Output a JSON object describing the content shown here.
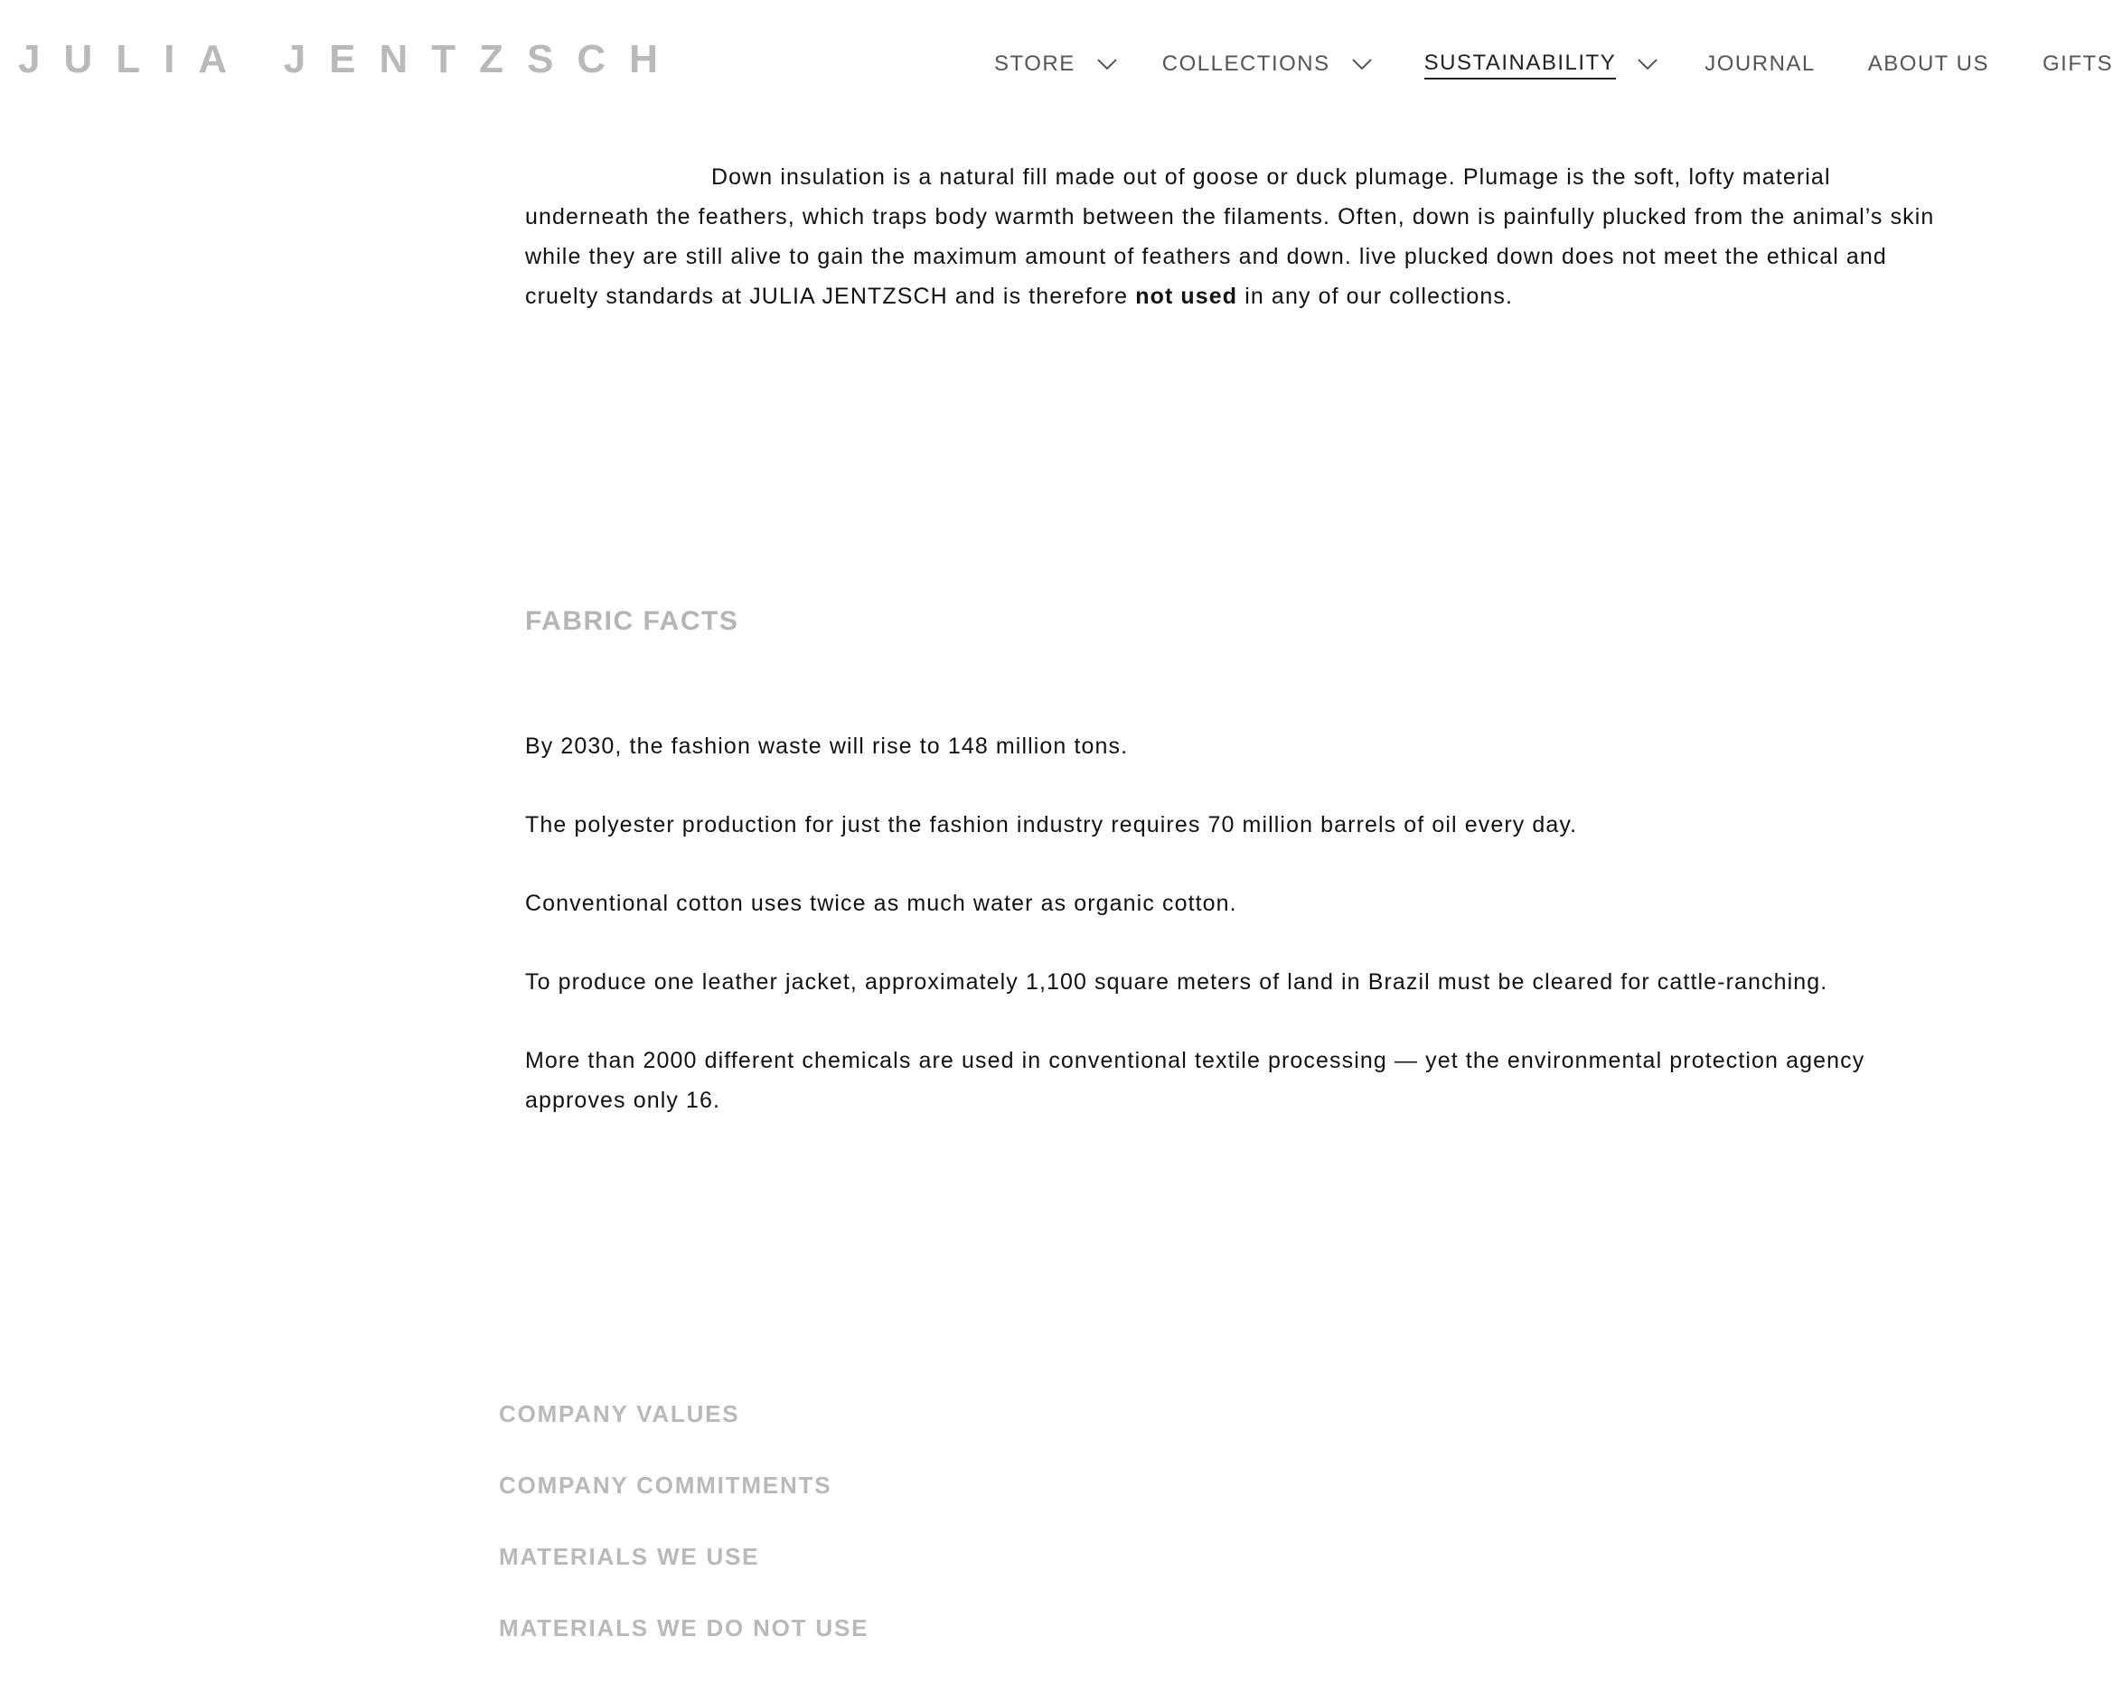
{
  "brand": {
    "logo_text": "JULIA JENTZSCH"
  },
  "nav": {
    "items": [
      {
        "label": "STORE",
        "has_dropdown": true,
        "active": false
      },
      {
        "label": "COLLECTIONS",
        "has_dropdown": true,
        "active": false
      },
      {
        "label": "SUSTAINABILITY",
        "has_dropdown": true,
        "active": true
      },
      {
        "label": "JOURNAL",
        "has_dropdown": false,
        "active": false
      },
      {
        "label": "ABOUT US",
        "has_dropdown": false,
        "active": false
      },
      {
        "label": "GIFTS",
        "has_dropdown": false,
        "active": false
      }
    ]
  },
  "main": {
    "intro": {
      "text_before": "Down insulation is a natural fill made out of goose or duck plumage. Plumage is the soft, lofty material underneath the feathers, which traps body warmth between the filaments. Often, down is painfully plucked from the animal’s skin while they are still alive to gain the maximum amount of feathers and down. live plucked down does not meet the ethical and cruelty standards at JULIA JENTZSCH and is therefore ",
      "bold": "not used",
      "text_after": " in any of our collections."
    },
    "fabric_facts": {
      "title": "FABRIC FACTS",
      "facts": [
        "By 2030, the fashion waste will rise to 148 million tons.",
        "The polyester production for just the fashion industry requires 70 million barrels of oil every day.",
        "Conventional cotton uses twice as much water as organic cotton.",
        "To produce one leather jacket, approximately 1,100 square meters of land in Brazil must be cleared for cattle-ranching.",
        "More than 2000 different chemicals are used in conventional textile processing — yet the environmental protection agency approves only 16."
      ]
    }
  },
  "footer": {
    "links": [
      "COMPANY VALUES",
      "COMPANY COMMITMENTS",
      "MATERIALS WE USE",
      "MATERIALS WE DO NOT USE"
    ]
  },
  "colors": {
    "logo": "#b9b9b9",
    "nav_text": "#555555",
    "nav_active": "#222222",
    "body_text": "#111111",
    "section_title": "#b5b5b5",
    "footer_link": "#b9b9b9"
  },
  "icons": {
    "dropdown": "chevron-down-icon"
  }
}
